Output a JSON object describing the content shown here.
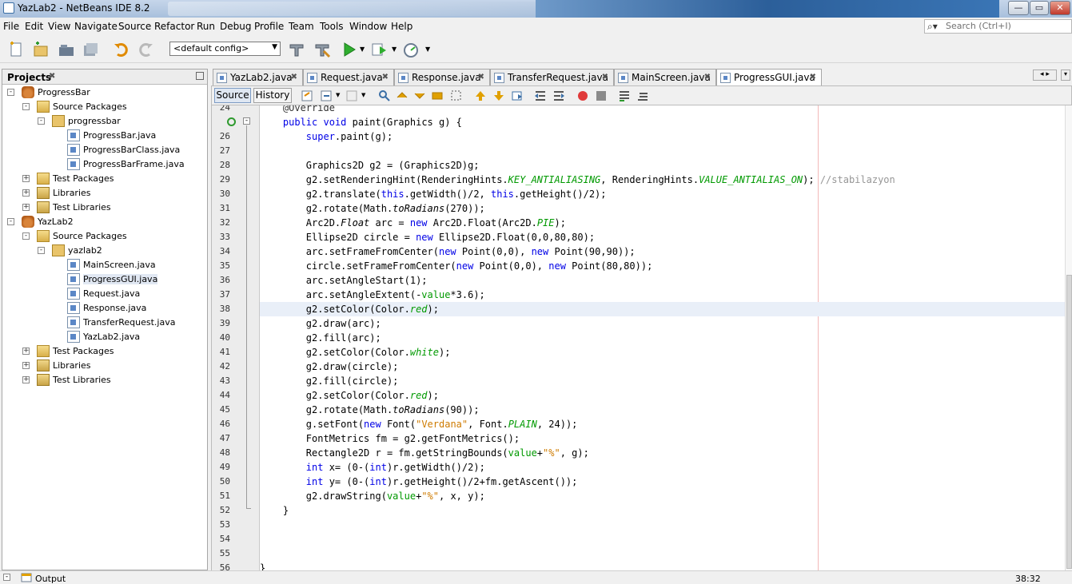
{
  "window": {
    "title": "YazLab2 - NetBeans IDE 8.2"
  },
  "menu": [
    "File",
    "Edit",
    "View",
    "Navigate",
    "Source",
    "Refactor",
    "Run",
    "Debug",
    "Profile",
    "Team",
    "Tools",
    "Window",
    "Help"
  ],
  "search": {
    "placeholder": "Search (Ctrl+I)"
  },
  "toolbar": {
    "config": "<default config>"
  },
  "projects": {
    "title": "Projects",
    "tree": [
      {
        "label": "ProgressBar",
        "icon": "project-icon",
        "depth": 0,
        "expanded": true
      },
      {
        "label": "Source Packages",
        "icon": "folder-icon",
        "depth": 1,
        "expanded": true
      },
      {
        "label": "progressbar",
        "icon": "package-icon",
        "depth": 2,
        "expanded": true
      },
      {
        "label": "ProgressBar.java",
        "icon": "java-file-icon",
        "depth": 3
      },
      {
        "label": "ProgressBarClass.java",
        "icon": "java-file-icon",
        "depth": 3
      },
      {
        "label": "ProgressBarFrame.java",
        "icon": "java-file-icon",
        "depth": 3
      },
      {
        "label": "Test Packages",
        "icon": "folder-icon",
        "depth": 1,
        "expanded": false
      },
      {
        "label": "Libraries",
        "icon": "library-icon",
        "depth": 1,
        "expanded": false
      },
      {
        "label": "Test Libraries",
        "icon": "library-icon",
        "depth": 1,
        "expanded": false
      },
      {
        "label": "YazLab2",
        "icon": "project-icon",
        "depth": 0,
        "expanded": true
      },
      {
        "label": "Source Packages",
        "icon": "folder-icon",
        "depth": 1,
        "expanded": true
      },
      {
        "label": "yazlab2",
        "icon": "package-icon",
        "depth": 2,
        "expanded": true
      },
      {
        "label": "MainScreen.java",
        "icon": "java-file-icon",
        "depth": 3
      },
      {
        "label": "ProgressGUI.java",
        "icon": "java-file-icon",
        "depth": 3,
        "selected": true
      },
      {
        "label": "Request.java",
        "icon": "java-file-icon",
        "depth": 3
      },
      {
        "label": "Response.java",
        "icon": "java-file-icon",
        "depth": 3
      },
      {
        "label": "TransferRequest.java",
        "icon": "java-file-icon",
        "depth": 3
      },
      {
        "label": "YazLab2.java",
        "icon": "java-file-icon",
        "depth": 3
      },
      {
        "label": "Test Packages",
        "icon": "folder-icon",
        "depth": 1,
        "expanded": false
      },
      {
        "label": "Libraries",
        "icon": "library-icon",
        "depth": 1,
        "expanded": false
      },
      {
        "label": "Test Libraries",
        "icon": "library-icon",
        "depth": 1,
        "expanded": false
      }
    ]
  },
  "tabs": [
    {
      "label": "YazLab2.java"
    },
    {
      "label": "Request.java"
    },
    {
      "label": "Response.java"
    },
    {
      "label": "TransferRequest.java"
    },
    {
      "label": "MainScreen.java"
    },
    {
      "label": "ProgressGUI.java",
      "active": true
    }
  ],
  "editor_toolbar": {
    "source_label": "Source",
    "history_label": "History"
  },
  "editor": {
    "lines": [
      {
        "n": "24",
        "html": "    <span class=\"ann\">@Override</span>"
      },
      {
        "n": "",
        "html": "    <span class=\"kw\">public</span> <span class=\"kw\">void</span> paint(Graphics g) {"
      },
      {
        "n": "26",
        "html": "        <span class=\"kw\">super</span>.paint(g);"
      },
      {
        "n": "27",
        "html": ""
      },
      {
        "n": "28",
        "html": "        Graphics2D g2 = (Graphics2D)g;"
      },
      {
        "n": "29",
        "html": "        g2.setRenderingHint(RenderingHints.<span class=\"fld\">KEY_ANTIALIASING</span>, RenderingHints.<span class=\"fld\">VALUE_ANTIALIAS_ON</span>); <span class=\"cmt\">//stabilazyon</span>"
      },
      {
        "n": "30",
        "html": "        g2.translate(<span class=\"kw\">this</span>.getWidth()/2, <span class=\"kw\">this</span>.getHeight()/2);"
      },
      {
        "n": "31",
        "html": "        g2.rotate(Math.<span class=\"it\">toRadians</span>(270));"
      },
      {
        "n": "32",
        "html": "        Arc2D.<span class=\"it\">Float</span> arc = <span class=\"kw\">new</span> Arc2D.Float(Arc2D.<span class=\"fld\">PIE</span>);"
      },
      {
        "n": "33",
        "html": "        Ellipse2D circle = <span class=\"kw\">new</span> Ellipse2D.Float(0,0,80,80);"
      },
      {
        "n": "34",
        "html": "        arc.setFrameFromCenter(<span class=\"kw\">new</span> Point(0,0), <span class=\"kw\">new</span> Point(90,90));"
      },
      {
        "n": "35",
        "html": "        circle.setFrameFromCenter(<span class=\"kw\">new</span> Point(0,0), <span class=\"kw\">new</span> Point(80,80));"
      },
      {
        "n": "36",
        "html": "        arc.setAngleStart(1);"
      },
      {
        "n": "37",
        "html": "        arc.setAngleExtent(-<span class=\"fld\" style=\"font-style:normal\">value</span>*3.6);"
      },
      {
        "n": "38",
        "html": "        g2.setColor(Color.<span class=\"fld\">red</span>);",
        "current": true
      },
      {
        "n": "39",
        "html": "        g2.draw(arc);"
      },
      {
        "n": "40",
        "html": "        g2.fill(arc);"
      },
      {
        "n": "41",
        "html": "        g2.setColor(Color.<span class=\"fld\">white</span>);"
      },
      {
        "n": "42",
        "html": "        g2.draw(circle);"
      },
      {
        "n": "43",
        "html": "        g2.fill(circle);"
      },
      {
        "n": "44",
        "html": "        g2.setColor(Color.<span class=\"fld\">red</span>);"
      },
      {
        "n": "45",
        "html": "        g2.rotate(Math.<span class=\"it\">toRadians</span>(90));"
      },
      {
        "n": "46",
        "html": "        g.setFont(<span class=\"kw\">new</span> Font(<span class=\"str\">\"Verdana\"</span>, Font.<span class=\"fld\">PLAIN</span>, 24));"
      },
      {
        "n": "47",
        "html": "        FontMetrics fm = g2.getFontMetrics();"
      },
      {
        "n": "48",
        "html": "        Rectangle2D r = fm.getStringBounds(<span class=\"fld\" style=\"font-style:normal\">value</span>+<span class=\"str\">\"%\"</span>, g);"
      },
      {
        "n": "49",
        "html": "        <span class=\"kw\">int</span> x= (0-(<span class=\"kw\">int</span>)r.getWidth()/2);"
      },
      {
        "n": "50",
        "html": "        <span class=\"kw\">int</span> y= (0-(<span class=\"kw\">int</span>)r.getHeight()/2+fm.getAscent());"
      },
      {
        "n": "51",
        "html": "        g2.drawString(<span class=\"fld\" style=\"font-style:normal\">value</span>+<span class=\"str\">\"%\"</span>, x, y);"
      },
      {
        "n": "52",
        "html": "    }"
      },
      {
        "n": "53",
        "html": ""
      },
      {
        "n": "54",
        "html": ""
      },
      {
        "n": "55",
        "html": ""
      },
      {
        "n": "56",
        "html": "}"
      }
    ]
  },
  "statusbar": {
    "output_label": "Output",
    "position": "38:32"
  }
}
